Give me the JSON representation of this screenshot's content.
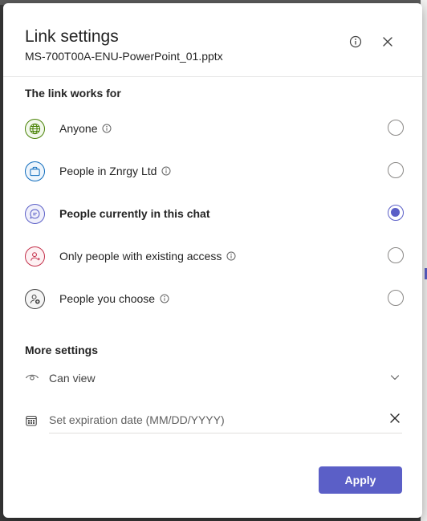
{
  "dialog": {
    "title": "Link settings",
    "filename": "MS-700T00A-ENU-PowerPoint_01.pptx"
  },
  "header_icons": {
    "info": "info-icon",
    "close": "close-icon"
  },
  "link_works_for": {
    "label": "The link works for",
    "options": [
      {
        "label": "Anyone",
        "icon": "globe-icon",
        "icon_color": "#498205",
        "has_info": true,
        "selected": false
      },
      {
        "label": "People in Znrgy Ltd",
        "icon": "briefcase-icon",
        "icon_color": "#0f6cbd",
        "has_info": true,
        "selected": false
      },
      {
        "label": "People currently in this chat",
        "icon": "chat-icon",
        "icon_color": "#5b5fc7",
        "has_info": false,
        "selected": true
      },
      {
        "label": "Only people with existing access",
        "icon": "person-arrow-icon",
        "icon_color": "#c4314b",
        "has_info": true,
        "selected": false
      },
      {
        "label": "People you choose",
        "icon": "person-add-icon",
        "icon_color": "#424242",
        "has_info": true,
        "selected": false
      }
    ]
  },
  "more_settings": {
    "label": "More settings",
    "permission": {
      "value": "Can view",
      "icon": "eye-icon"
    },
    "expiration": {
      "placeholder": "Set expiration date (MM/DD/YYYY)",
      "icon": "calendar-icon"
    }
  },
  "actions": {
    "apply_label": "Apply"
  },
  "colors": {
    "accent": "#5b5fc7",
    "text": "#242424"
  }
}
